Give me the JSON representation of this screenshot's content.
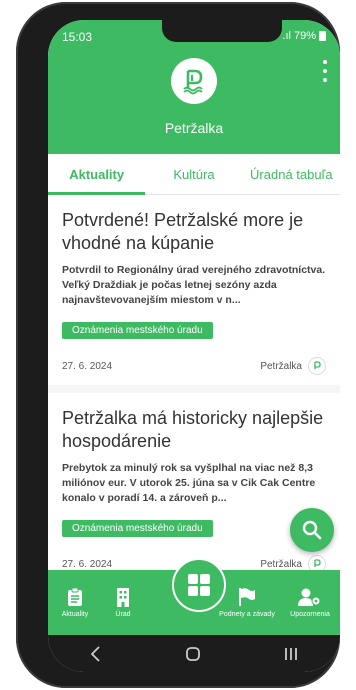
{
  "status": {
    "time": "15:03",
    "battery": "79%"
  },
  "header": {
    "title": "Petržalka"
  },
  "tabs": [
    {
      "label": "Aktuality"
    },
    {
      "label": "Kultúra"
    },
    {
      "label": "Úradná tabuľa"
    }
  ],
  "articles": [
    {
      "title": "Potvrdené! Petržalské more je vhodné na kúpanie",
      "excerpt": "Potvrdil to Regionálny úrad verejného zdravotníctva. Veľký Draždiak je počas letnej sezóny azda najnavštevovanejším miestom v n...",
      "tag": "Oznámenia mestského úradu",
      "date": "27. 6. 2024",
      "source": "Petržalka"
    },
    {
      "title": "Petržalka má historicky najlepšie hospodárenie",
      "excerpt": "Prebytok za minulý rok sa vyšplhal na viac než 8,3 miliónov eur. V utorok 25. júna sa v Cik Cak Centre konalo v poradí 14. a zároveň p...",
      "tag": "Oznámenia mestského úradu",
      "date": "27. 6. 2024",
      "source": "Petržalka"
    }
  ],
  "bottom_nav": {
    "aktuality": "Aktuality",
    "urad": "Úrad",
    "podnety": "Podnety a závady",
    "upozornenia": "Upozornenia"
  },
  "colors": {
    "accent": "#3dba62"
  }
}
